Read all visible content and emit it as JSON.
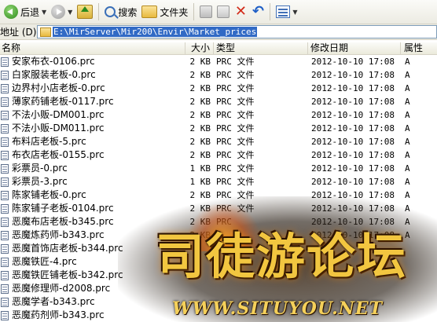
{
  "toolbar": {
    "back_label": "后退",
    "search_label": "搜索",
    "folders_label": "文件夹"
  },
  "address": {
    "label": "地址 (D)",
    "path": "E:\\MirServer\\Mir200\\Envir\\Market_prices"
  },
  "columns": {
    "name": "名称",
    "size": "大小",
    "type": "类型",
    "modified": "修改日期",
    "attributes": "属性"
  },
  "files": [
    {
      "name": "安家布衣-0106.prc",
      "size": "2 KB",
      "type": "PRC 文件",
      "date": "2012-10-10 17:08",
      "attr": "A"
    },
    {
      "name": "白家服装老板-0.prc",
      "size": "2 KB",
      "type": "PRC 文件",
      "date": "2012-10-10 17:08",
      "attr": "A"
    },
    {
      "name": "边界村小店老板-0.prc",
      "size": "2 KB",
      "type": "PRC 文件",
      "date": "2012-10-10 17:08",
      "attr": "A"
    },
    {
      "name": "薄家药铺老板-0117.prc",
      "size": "2 KB",
      "type": "PRC 文件",
      "date": "2012-10-10 17:08",
      "attr": "A"
    },
    {
      "name": "不法小贩-DM001.prc",
      "size": "2 KB",
      "type": "PRC 文件",
      "date": "2012-10-10 17:08",
      "attr": "A"
    },
    {
      "name": "不法小贩-DM011.prc",
      "size": "2 KB",
      "type": "PRC 文件",
      "date": "2012-10-10 17:08",
      "attr": "A"
    },
    {
      "name": "布料店老板-5.prc",
      "size": "2 KB",
      "type": "PRC 文件",
      "date": "2012-10-10 17:08",
      "attr": "A"
    },
    {
      "name": "布衣店老板-0155.prc",
      "size": "2 KB",
      "type": "PRC 文件",
      "date": "2012-10-10 17:08",
      "attr": "A"
    },
    {
      "name": "彩票员-0.prc",
      "size": "1 KB",
      "type": "PRC 文件",
      "date": "2012-10-10 17:08",
      "attr": "A"
    },
    {
      "name": "彩票员-3.prc",
      "size": "1 KB",
      "type": "PRC 文件",
      "date": "2012-10-10 17:08",
      "attr": "A"
    },
    {
      "name": "陈家铺老板-0.prc",
      "size": "2 KB",
      "type": "PRC 文件",
      "date": "2012-10-10 17:08",
      "attr": "A"
    },
    {
      "name": "陈家铺子老板-0104.prc",
      "size": "2 KB",
      "type": "PRC 文件",
      "date": "2012-10-10 17:08",
      "attr": "A"
    },
    {
      "name": "恶魔布店老板-b345.prc",
      "size": "2 KB",
      "type": "PRC",
      "date": "2012-10-10 17:08",
      "attr": "A"
    },
    {
      "name": "恶魔炼药师-b343.prc",
      "size": "2 KB",
      "type": "",
      "date": "2012-10-10 17:08",
      "attr": "A"
    },
    {
      "name": "恶魔首饰店老板-b344.prc",
      "size": "",
      "type": "",
      "date": "",
      "attr": ""
    },
    {
      "name": "恶魔铁匠-4.prc",
      "size": "",
      "type": "",
      "date": "",
      "attr": ""
    },
    {
      "name": "恶魔铁匠铺老板-b342.prc",
      "size": "",
      "type": "",
      "date": "",
      "attr": ""
    },
    {
      "name": "恶魔修理师-d2008.prc",
      "size": "",
      "type": "",
      "date": "",
      "attr": ""
    },
    {
      "name": "恶魔学者-b343.prc",
      "size": "",
      "type": "",
      "date": "",
      "attr": ""
    },
    {
      "name": "恶魔药剂师-b343.prc",
      "size": "",
      "type": "",
      "date": "",
      "attr": ""
    }
  ],
  "watermark": {
    "title": "司徒游论坛",
    "subtitle": "WWW.SITUYOU.NET"
  }
}
